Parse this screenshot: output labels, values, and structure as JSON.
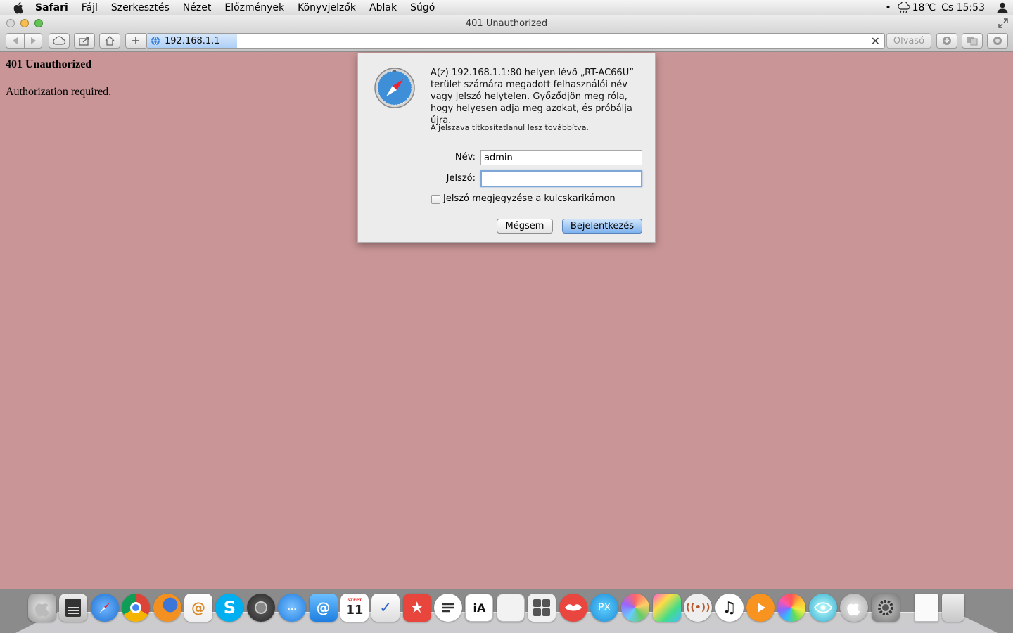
{
  "menubar": {
    "app_name": "Safari",
    "items": [
      "Fájl",
      "Szerkesztés",
      "Nézet",
      "Előzmények",
      "Könyvjelzők",
      "Ablak",
      "Súgó"
    ],
    "status_dot": "•",
    "weather": "18℃",
    "clock": "Cs 15:53"
  },
  "window": {
    "title": "401 Unauthorized"
  },
  "toolbar": {
    "url": "192.168.1.1",
    "reader_label": "Olvasó",
    "clear_symbol": "✕",
    "load_progress_percent": 12
  },
  "page": {
    "heading": "401 Unauthorized",
    "text": "Authorization required."
  },
  "auth_dialog": {
    "message": "A(z) 192.168.1.1:80 helyen lévő „RT-AC66U” terület számára megadott felhasználói név vagy jelszó helytelen. Győződjön meg róla, hogy helyesen adja meg azokat, és próbálja újra.",
    "note": "A jelszava titkosítatlanul lesz továbbítva.",
    "name_label": "Név:",
    "name_value": "admin",
    "password_label": "Jelszó:",
    "password_value": "",
    "remember_label": "Jelszó megjegyzése a kulcskarikámon",
    "remember_checked": false,
    "cancel_label": "Mégsem",
    "login_label": "Bejelentkezés"
  },
  "dock": {
    "calendar_day": "11",
    "calendar_month": "SZEPT",
    "pixelmator_label": "PX",
    "ia_writer_label": "iA",
    "items": [
      "finder",
      "storage",
      "safari",
      "chrome",
      "firefox",
      "mail-stamp",
      "skype",
      "camera",
      "messages",
      "mail",
      "calendar",
      "tasks",
      "bookmarks",
      "notes-lines",
      "ia-writer",
      "document",
      "calculator",
      "lips",
      "pixelmator",
      "aperture",
      "colors",
      "broadcast",
      "itunes",
      "infuse",
      "photos",
      "eye",
      "apple",
      "system-preferences",
      "txt-file",
      "trash"
    ]
  },
  "colors": {
    "page_background": "#c99596",
    "primary_button": "#7fb2ee"
  }
}
